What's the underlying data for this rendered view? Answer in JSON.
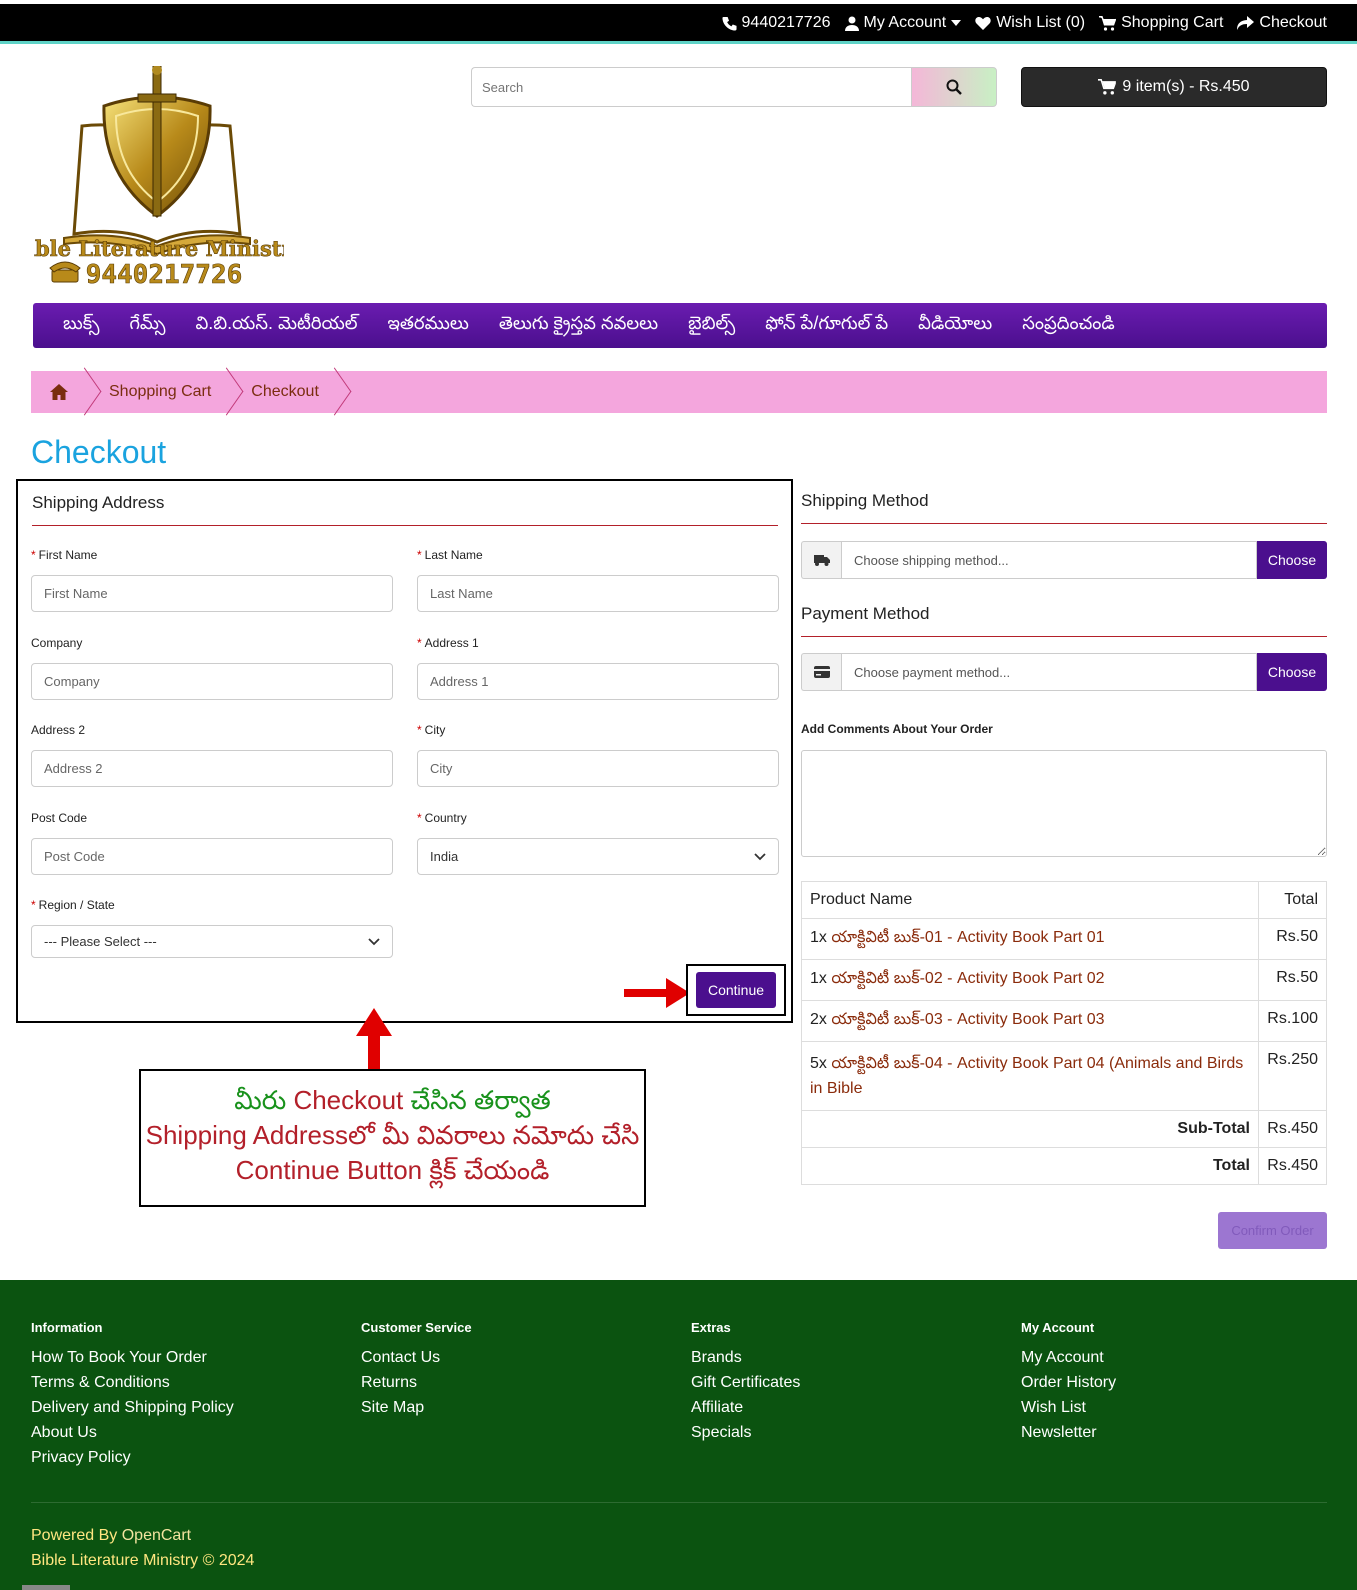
{
  "topbar": {
    "phone": "9440217726",
    "my_account": "My Account",
    "wish_list": "Wish List (0)",
    "shopping_cart": "Shopping Cart",
    "checkout": "Checkout"
  },
  "logo": {
    "name": "Bible Literature Ministry",
    "phone": "9440217726"
  },
  "search": {
    "placeholder": "Search"
  },
  "cart_button": "9 item(s) - Rs.450",
  "menu": [
    "బుక్స్",
    "గేమ్స్",
    "వి.బి.యస్. మెటీరియల్",
    "ఇతరములు",
    "తెలుగు క్రైస్తవ నవలలు",
    "బైబిల్స్",
    "ఫోన్ పే/గూగుల్ పే",
    "వీడియోలు",
    "సంప్రదించండి"
  ],
  "breadcrumb": [
    "Shopping Cart",
    "Checkout"
  ],
  "page_title": "Checkout",
  "shipping_address": {
    "heading": "Shipping Address",
    "first_name": {
      "label": "First Name",
      "placeholder": "First Name"
    },
    "last_name": {
      "label": "Last Name",
      "placeholder": "Last Name"
    },
    "company": {
      "label": "Company",
      "placeholder": "Company"
    },
    "address1": {
      "label": "Address 1",
      "placeholder": "Address 1"
    },
    "address2": {
      "label": "Address 2",
      "placeholder": "Address 2"
    },
    "city": {
      "label": "City",
      "placeholder": "City"
    },
    "post_code": {
      "label": "Post Code",
      "placeholder": "Post Code"
    },
    "country": {
      "label": "Country",
      "value": "India"
    },
    "region": {
      "label": "Region / State",
      "value": "--- Please Select ---"
    },
    "continue_label": "Continue"
  },
  "shipping_method": {
    "heading": "Shipping Method",
    "placeholder": "Choose shipping method...",
    "button": "Choose"
  },
  "payment_method": {
    "heading": "Payment Method",
    "placeholder": "Choose payment method...",
    "button": "Choose"
  },
  "comments_label": "Add Comments About Your Order",
  "order_table": {
    "col_product": "Product Name",
    "col_total": "Total",
    "rows": [
      {
        "qty": "1x",
        "name": "యాక్టివిటీ బుక్-01 - Activity Book Part 01",
        "total": "Rs.50"
      },
      {
        "qty": "1x",
        "name": "యాక్టివిటీ బుక్-02 - Activity Book Part 02",
        "total": "Rs.50"
      },
      {
        "qty": "2x",
        "name": "యాక్టివిటీ బుక్-03 - Activity Book Part 03",
        "total": "Rs.100"
      },
      {
        "qty": "5x",
        "name": "యాక్టివిటీ బుక్-04 - Activity Book Part 04 (Animals and Birds in Bible",
        "total": "Rs.250"
      }
    ],
    "subtotal_label": "Sub-Total",
    "subtotal": "Rs.450",
    "total_label": "Total",
    "total": "Rs.450"
  },
  "confirm_order": "Confirm Order",
  "annotation": {
    "line1_a": "మీరు ",
    "line1_b": "Checkout",
    "line1_c": " చేసిన తర్వాత",
    "line2_a": "Shipping Address",
    "line2_b": "లో మీ వివరాలు నమోదు చేసి",
    "line3_a": "Continue Button",
    "line3_b": " క్లిక్ చేయండి"
  },
  "footer": {
    "information": {
      "title": "Information",
      "links": [
        "How To Book Your Order",
        "Terms & Conditions",
        "Delivery and Shipping Policy",
        "About Us",
        "Privacy Policy"
      ]
    },
    "customer_service": {
      "title": "Customer Service",
      "links": [
        "Contact Us",
        "Returns",
        "Site Map"
      ]
    },
    "extras": {
      "title": "Extras",
      "links": [
        "Brands",
        "Gift Certificates",
        "Affiliate",
        "Specials"
      ]
    },
    "my_account": {
      "title": "My Account",
      "links": [
        "My Account",
        "Order History",
        "Wish List",
        "Newsletter"
      ]
    },
    "powered_by": "Powered By ",
    "opencart": "OpenCart",
    "copyright": "Bible Literature Ministry © 2024"
  },
  "colors": {
    "menu_purple": "#4b0f8e",
    "breadcrumb_pink": "#f4a6dd",
    "title_blue": "#1aa3df",
    "footer_green": "#0b5310",
    "annotation_arrow_red": "#e00000"
  }
}
